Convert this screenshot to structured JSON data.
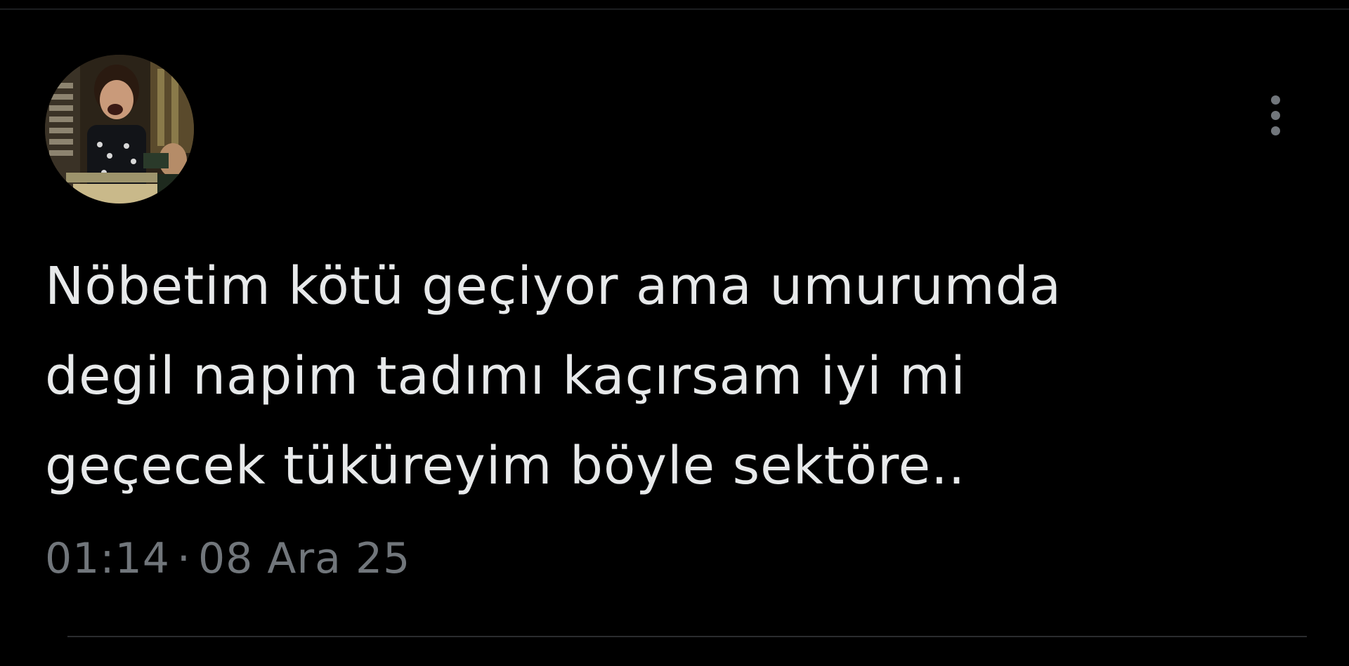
{
  "tweet": {
    "text": "Nöbetim kötü geçiyor ama umurumda\ndegil napim tadımı kaçırsam iyi mi\ngeçecek tüküreyim böyle sektöre..",
    "time": "01:14",
    "separator": "·",
    "date": "08 Ara 25"
  },
  "icons": {
    "more": "more-vertical-icon",
    "avatar": "profile-avatar"
  },
  "colors": {
    "background": "#000000",
    "text": "#e7e9ea",
    "secondary": "#71767b",
    "divider": "#2a2c2f"
  }
}
